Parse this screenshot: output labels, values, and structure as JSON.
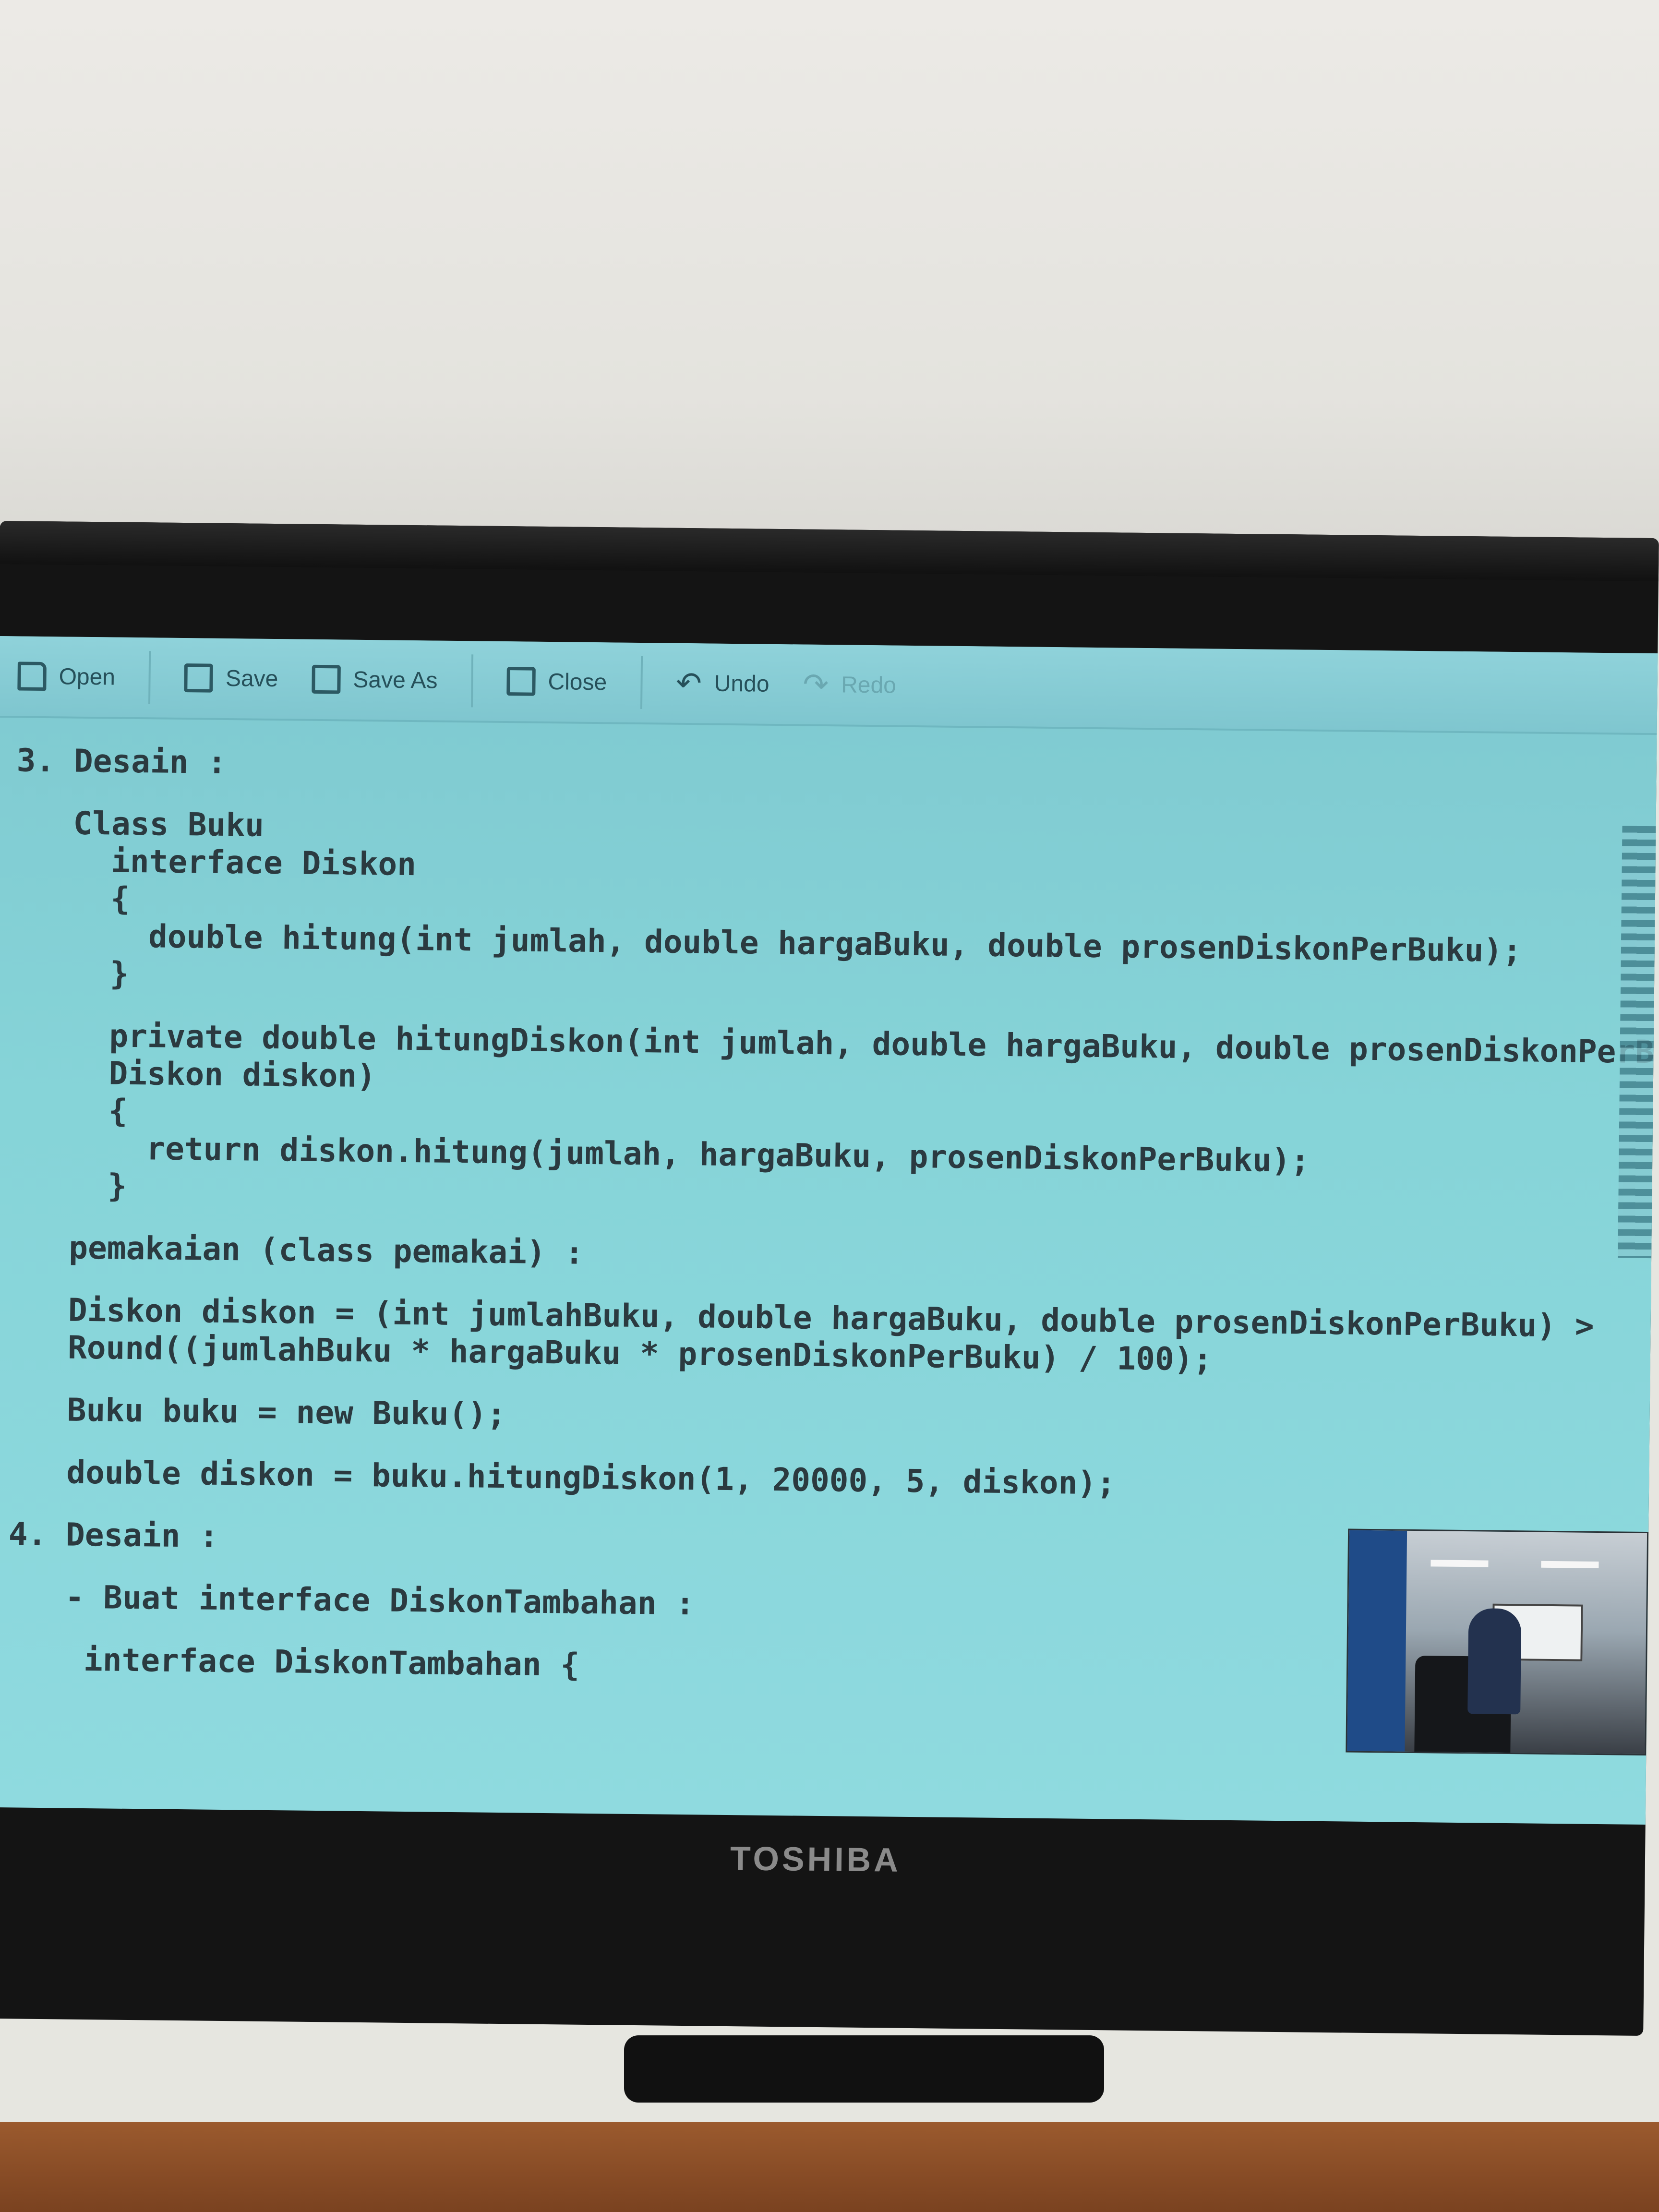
{
  "toolbar": {
    "open": "Open",
    "save": "Save",
    "save_as": "Save As",
    "close": "Close",
    "undo": "Undo",
    "redo": "Redo"
  },
  "code_lines": [
    "3. Desain :",
    "",
    "   Class Buku",
    "     interface Diskon",
    "     {",
    "       double hitung(int jumlah, double hargaBuku, double prosenDiskonPerBuku);",
    "     }",
    "",
    "     private double hitungDiskon(int jumlah, double hargaBuku, double prosenDiskonPerBuku,",
    "     Diskon diskon)",
    "     {",
    "       return diskon.hitung(jumlah, hargaBuku, prosenDiskonPerBuku);",
    "     }",
    "",
    "   pemakaian (class pemakai) :",
    "",
    "   Diskon diskon = (int jumlahBuku, double hargaBuku, double prosenDiskonPerBuku) >",
    "   Round((jumlahBuku * hargaBuku * prosenDiskonPerBuku) / 100);",
    "",
    "   Buku buku = new Buku();",
    "",
    "   double diskon = buku.hitungDiskon(1, 20000, 5, diskon);",
    "",
    "4. Desain :",
    "",
    "   - Buat interface DiskonTambahan :",
    "",
    "    interface DiskonTambahan {"
  ],
  "brand": "TOSHIBA"
}
